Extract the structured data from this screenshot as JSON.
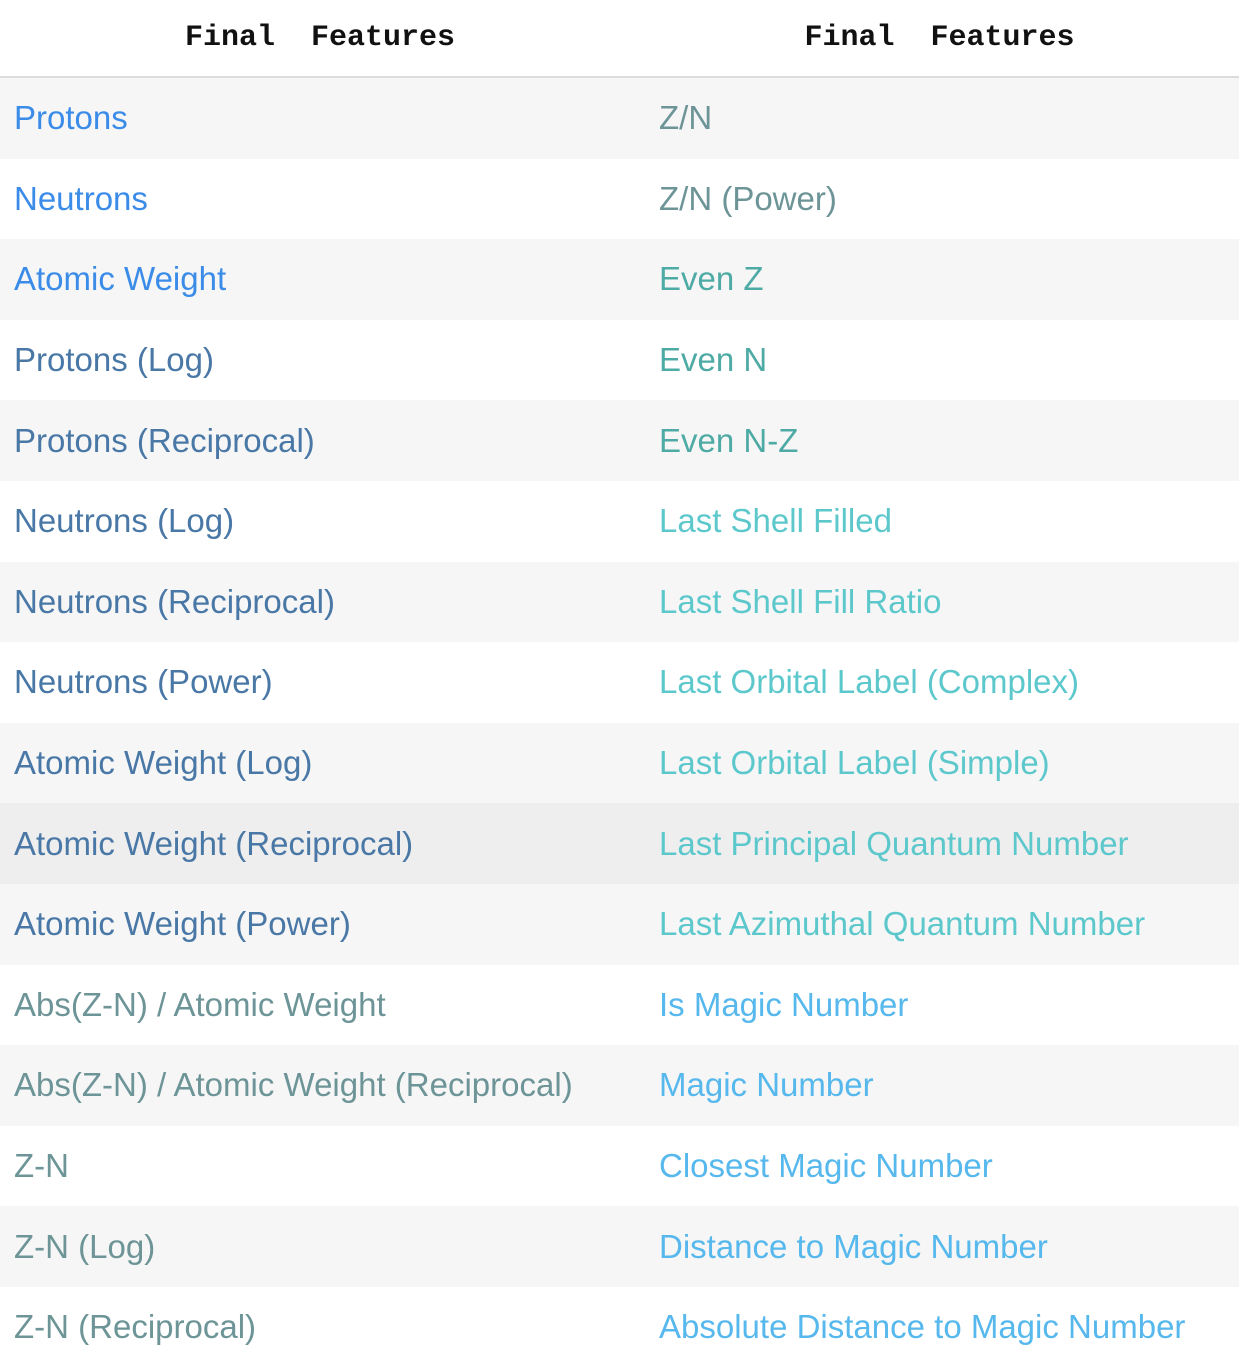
{
  "header": {
    "col1": "Final  Features",
    "col2": "Final  Features"
  },
  "rows": [
    {
      "left": "Protons",
      "left_color": "#3b8ce8",
      "right": "Z/N",
      "right_color": "#6d9497"
    },
    {
      "left": "Neutrons",
      "left_color": "#3b8ce8",
      "right": "Z/N (Power)",
      "right_color": "#6d9497"
    },
    {
      "left": "Atomic Weight",
      "left_color": "#3b8ce8",
      "right": "Even Z",
      "right_color": "#4eaaa4"
    },
    {
      "left": "Protons (Log)",
      "left_color": "#4a78a6",
      "right": "Even N",
      "right_color": "#4eaaa4"
    },
    {
      "left": "Protons (Reciprocal)",
      "left_color": "#4a78a6",
      "right": "Even N-Z",
      "right_color": "#4eaaa4"
    },
    {
      "left": "Neutrons (Log)",
      "left_color": "#4a78a6",
      "right": "Last Shell Filled",
      "right_color": "#5cc8cc"
    },
    {
      "left": "Neutrons (Reciprocal)",
      "left_color": "#4a78a6",
      "right": "Last Shell Fill Ratio",
      "right_color": "#5cc8cc"
    },
    {
      "left": "Neutrons (Power)",
      "left_color": "#4a78a6",
      "right": "Last Orbital Label (Complex)",
      "right_color": "#5cc8cc"
    },
    {
      "left": "Atomic Weight (Log)",
      "left_color": "#4a78a6",
      "right": "Last Orbital Label (Simple)",
      "right_color": "#5cc8cc"
    },
    {
      "left": "Atomic Weight (Reciprocal)",
      "left_color": "#4a78a6",
      "right": "Last Principal Quantum Number",
      "right_color": "#5cc8cc",
      "highlighted": true
    },
    {
      "left": "Atomic Weight (Power)",
      "left_color": "#4a78a6",
      "right": "Last Azimuthal Quantum Number",
      "right_color": "#5cc8cc"
    },
    {
      "left": "Abs(Z-N) / Atomic Weight",
      "left_color": "#6d9497",
      "right": "Is Magic Number",
      "right_color": "#56b8ec"
    },
    {
      "left": "Abs(Z-N) / Atomic Weight (Reciprocal)",
      "left_color": "#6d9497",
      "right": "Magic Number",
      "right_color": "#56b8ec"
    },
    {
      "left": "Z-N",
      "left_color": "#6d9497",
      "right": "Closest Magic Number",
      "right_color": "#56b8ec"
    },
    {
      "left": "Z-N (Log)",
      "left_color": "#6d9497",
      "right": "Distance to Magic Number",
      "right_color": "#56b8ec"
    },
    {
      "left": "Z-N (Reciprocal)",
      "left_color": "#6d9497",
      "right": "Absolute Distance to Magic Number",
      "right_color": "#56b8ec"
    }
  ]
}
